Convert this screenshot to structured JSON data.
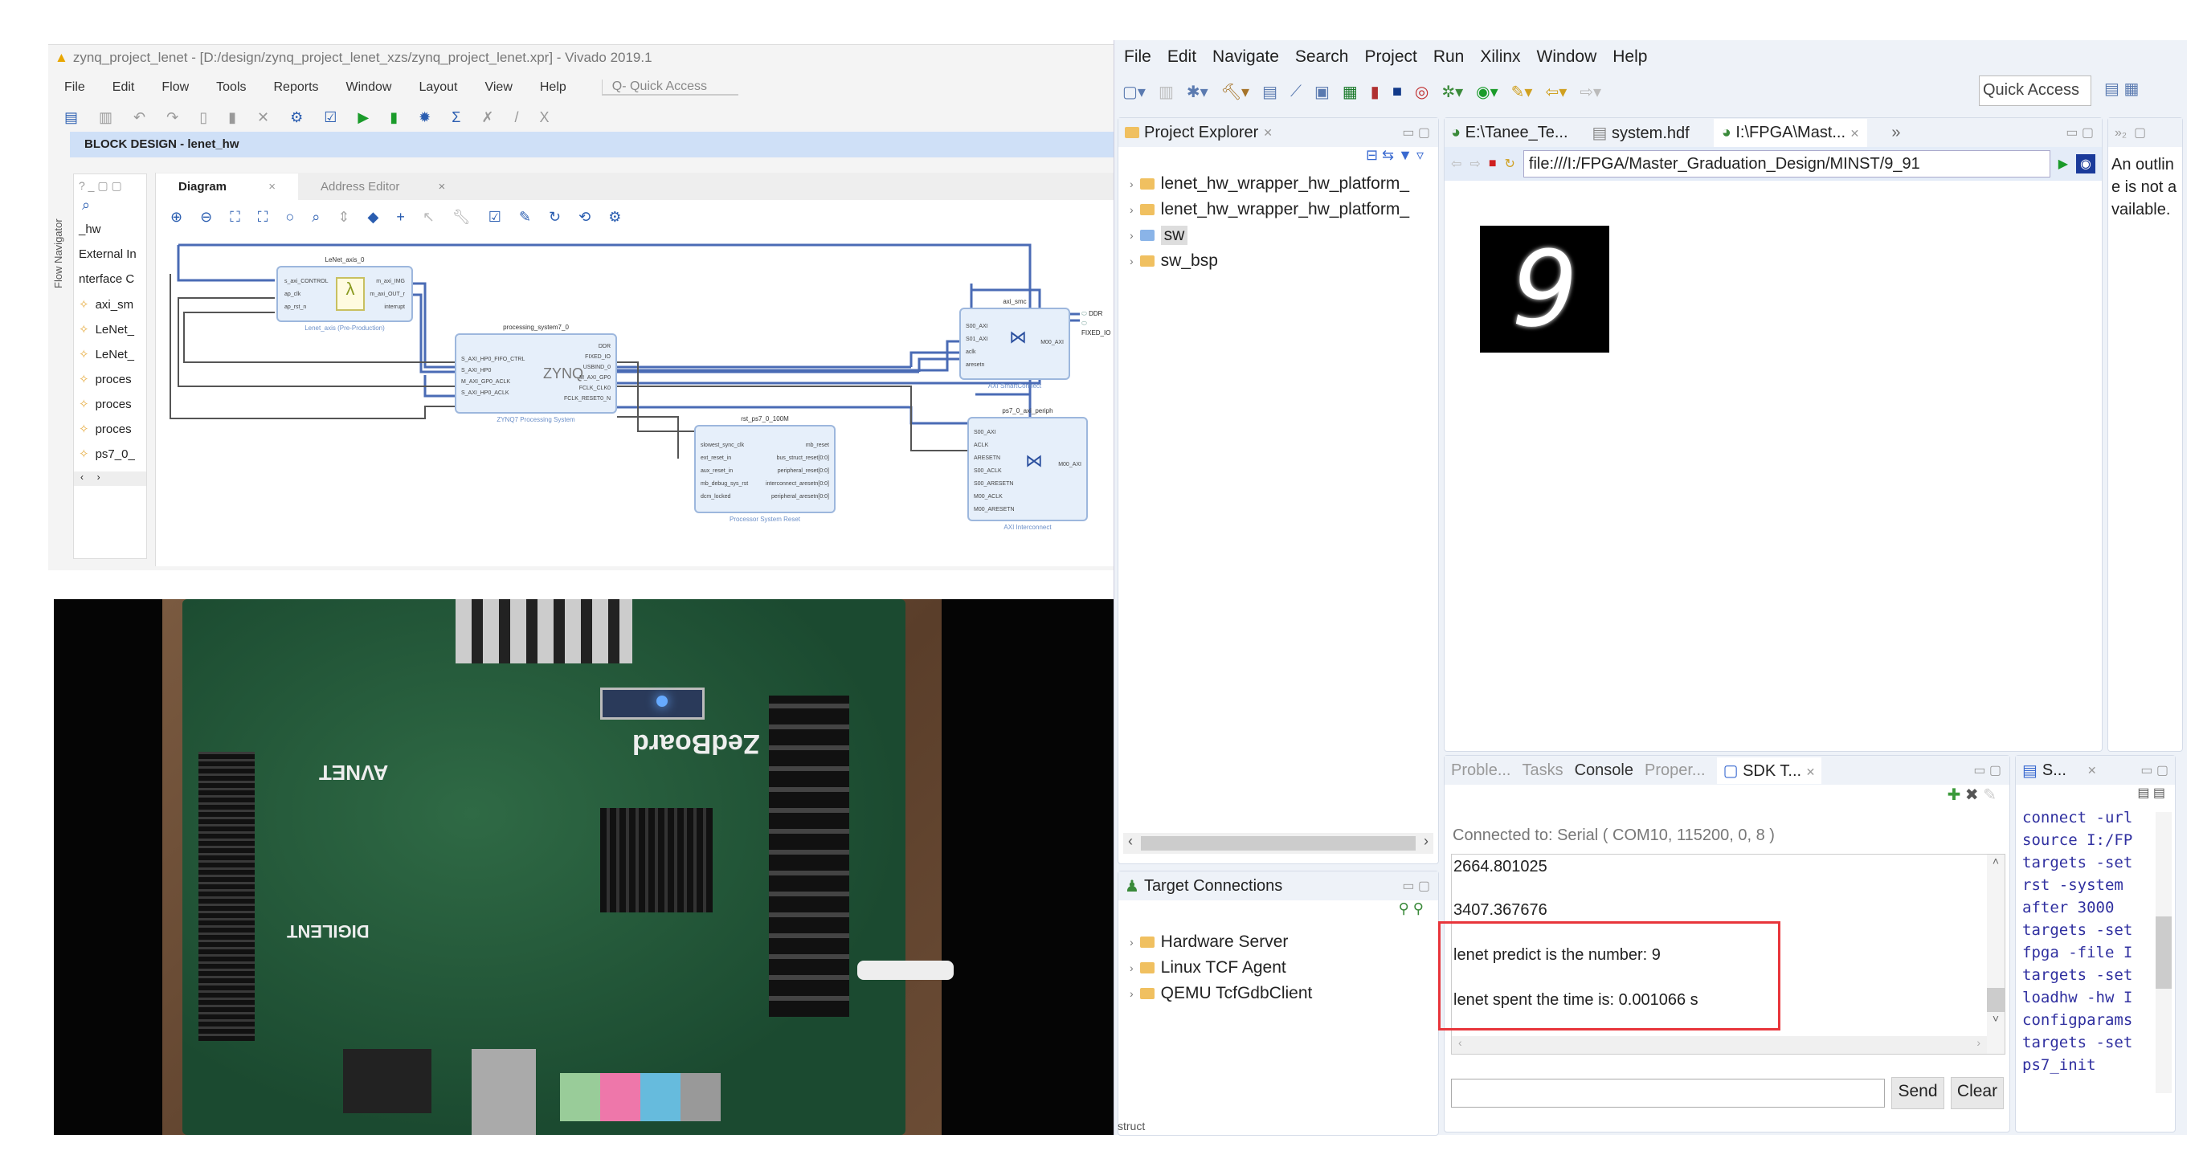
{
  "vivado": {
    "title": "zynq_project_lenet - [D:/design/zynq_project_lenet_xzs/zynq_project_lenet.xpr] - Vivado 2019.1",
    "menu": [
      "File",
      "Edit",
      "Flow",
      "Tools",
      "Reports",
      "Window",
      "Layout",
      "View",
      "Help"
    ],
    "quick_access": "Q- Quick Access",
    "block_design_header": "BLOCK DESIGN - lenet_hw",
    "flow_navigator": "Flow Navigator",
    "sources": [
      "_hw",
      "External In",
      "nterface C",
      "axi_sm",
      "LeNet_",
      "LeNet_",
      "proces",
      "proces",
      "proces",
      "ps7_0_"
    ],
    "tabs": [
      "Diagram",
      "Address Editor"
    ],
    "blocks": {
      "lenet": {
        "name": "LeNet_axis_0",
        "sub": "Lenet_axis (Pre-Production)",
        "ports_in": [
          "s_axi_CONTROL",
          "ap_clk",
          "ap_rst_n"
        ],
        "ports_out": [
          "m_axi_IMG",
          "m_axi_OUT_r",
          "interrupt"
        ]
      },
      "ps7": {
        "name": "processing_system7_0",
        "sub": "ZYNQ7 Processing System",
        "logo": "ZYNQ",
        "ports_in": [
          "S_AXI_HP0_FIFO_CTRL",
          "S_AXI_HP0",
          "M_AXI_GP0_ACLK",
          "S_AXI_HP0_ACLK"
        ],
        "ports_out": [
          "DDR",
          "FIXED_IO",
          "USBIND_0",
          "M_AXI_GP0",
          "FCLK_CLK0",
          "FCLK_RESET0_N"
        ]
      },
      "rst": {
        "name": "rst_ps7_0_100M",
        "sub": "Processor System Reset",
        "ports_in": [
          "slowest_sync_clk",
          "ext_reset_in",
          "aux_reset_in",
          "mb_debug_sys_rst",
          "dcm_locked"
        ],
        "ports_out": [
          "mb_reset",
          "bus_struct_reset[0:0]",
          "peripheral_reset[0:0]",
          "interconnect_aresetn[0:0]",
          "peripheral_aresetn[0:0]"
        ]
      },
      "smc": {
        "name": "axi_smc",
        "sub": "AXI SmartConnect",
        "ports_in": [
          "S00_AXI",
          "S01_AXI",
          "aclk",
          "aresetn"
        ],
        "ports_out": [
          "M00_AXI"
        ]
      },
      "periph": {
        "name": "ps7_0_axi_periph",
        "sub": "AXI Interconnect",
        "ports_in": [
          "S00_AXI",
          "ACLK",
          "ARESETN",
          "S00_ACLK",
          "S00_ARESETN",
          "M00_ACLK",
          "M00_ARESETN"
        ],
        "ports_out": [
          "M00_AXI"
        ]
      }
    },
    "external_ports": [
      "DDR",
      "FIXED_IO"
    ]
  },
  "photo": {
    "labels": [
      "ZedBoard",
      "AVNET",
      "DIGILENT"
    ]
  },
  "sdk": {
    "menu": [
      "File",
      "Edit",
      "Navigate",
      "Search",
      "Project",
      "Run",
      "Xilinx",
      "Window",
      "Help"
    ],
    "quick_access": "Quick Access",
    "project_explorer": {
      "title": "Project Explorer",
      "items": [
        "lenet_hw_wrapper_hw_platform_",
        "lenet_hw_wrapper_hw_platform_",
        "sw",
        "sw_bsp"
      ]
    },
    "editor_tabs": [
      "E:\\Tanee_Te...",
      "system.hdf",
      "I:\\FPGA\\Mast..."
    ],
    "url": "file:///I:/FPGA/Master_Graduation_Design/MINST/9_91",
    "digit": "9",
    "outline_msg": "An outline is not available.",
    "target_connections": {
      "title": "Target Connections",
      "items": [
        "Hardware Server",
        "Linux TCF Agent",
        "QEMU TcfGdbClient"
      ]
    },
    "console_tabs": [
      "Proble...",
      "Tasks",
      "Console",
      "Proper...",
      "SDK T..."
    ],
    "connected": "Connected to: Serial ( COM10, 115200, 0, 8 )",
    "lines": [
      "2664.801025",
      "3407.367676",
      "lenet predict is the number: 9",
      "lenet spent the time is: 0.001066 s"
    ],
    "send": "Send",
    "clear": "Clear",
    "side_tab": "S...",
    "log": [
      "connect -url",
      "source I:/FP",
      "targets -set",
      "rst -system",
      "after 3000",
      "targets -set",
      "fpga -file I",
      "targets -set",
      "loadhw -hw I",
      "configparams",
      "targets -set",
      "ps7_init"
    ],
    "status": "struct",
    "highlight_color": "#e8353b"
  }
}
